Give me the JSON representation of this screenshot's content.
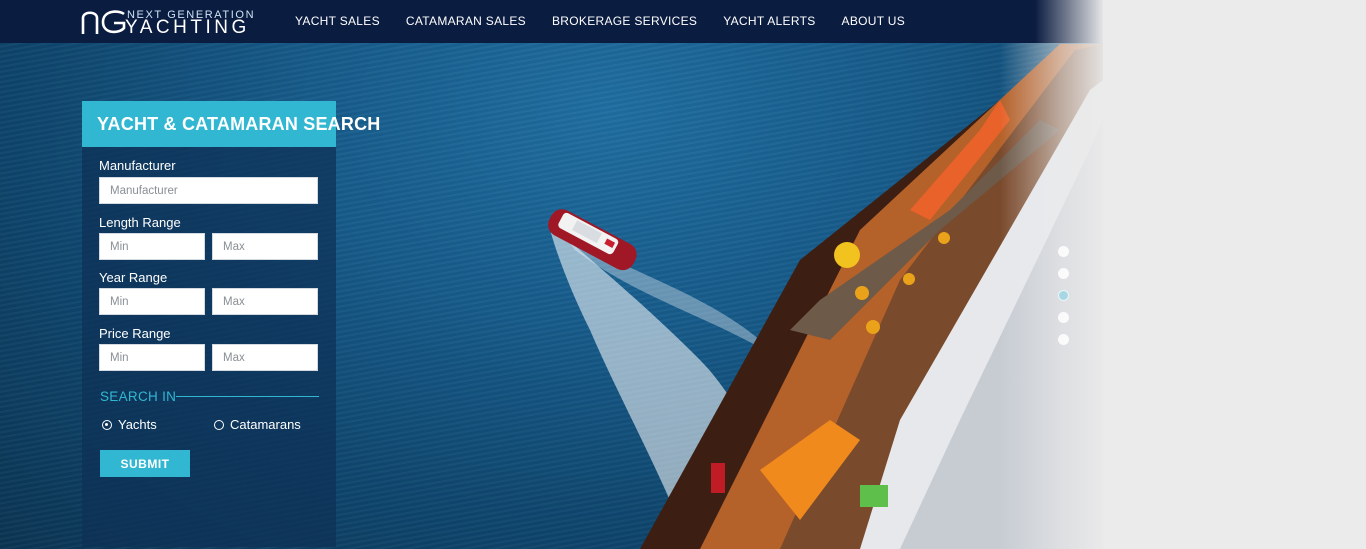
{
  "header": {
    "logo": {
      "line1": "NEXT GENERATION",
      "line2": "YACHTING",
      "mark": "NG"
    },
    "nav": [
      {
        "label": "YACHT SALES"
      },
      {
        "label": "CATAMARAN SALES"
      },
      {
        "label": "BROKERAGE SERVICES"
      },
      {
        "label": "YACHT ALERTS"
      },
      {
        "label": "ABOUT US"
      }
    ]
  },
  "search": {
    "title": "YACHT & CATAMARAN SEARCH",
    "manufacturer": {
      "label": "Manufacturer",
      "placeholder": "Manufacturer"
    },
    "length": {
      "label": "Length Range",
      "min": "Min",
      "max": "Max"
    },
    "year": {
      "label": "Year Range",
      "min": "Min",
      "max": "Max"
    },
    "price": {
      "label": "Price Range",
      "min": "Min",
      "max": "Max"
    },
    "search_in": {
      "heading": "SEARCH IN",
      "options": [
        {
          "label": "Yachts",
          "selected": true
        },
        {
          "label": "Catamarans",
          "selected": false
        }
      ]
    },
    "submit_label": "SUBMIT"
  },
  "slider": {
    "slide_count": 5,
    "active_index": 2
  },
  "colors": {
    "navbar": "#0b1c41",
    "accent": "#31b7d1",
    "panel": "#0e3156"
  }
}
